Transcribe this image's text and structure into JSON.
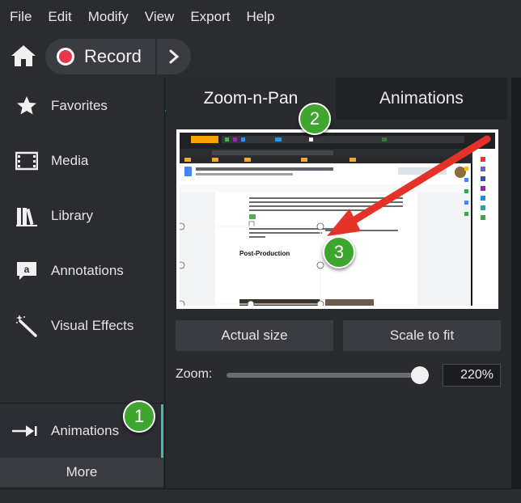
{
  "menubar": {
    "items": [
      "File",
      "Edit",
      "Modify",
      "View",
      "Export",
      "Help"
    ]
  },
  "toolbar": {
    "home_icon": "home-icon",
    "record_label": "Record",
    "next_icon": "chevron-right-icon"
  },
  "sidebar": {
    "items": [
      {
        "label": "Favorites",
        "icon": "star-icon"
      },
      {
        "label": "Media",
        "icon": "film-icon"
      },
      {
        "label": "Library",
        "icon": "books-icon"
      },
      {
        "label": "Annotations",
        "icon": "annotation-icon"
      },
      {
        "label": "Visual Effects",
        "icon": "magic-wand-icon"
      },
      {
        "label": "Animations",
        "icon": "animation-arrow-icon"
      }
    ],
    "active": "Animations",
    "more_label": "More"
  },
  "panel": {
    "tabs": [
      "Zoom-n-Pan",
      "Animations"
    ],
    "active_tab": "Zoom-n-Pan",
    "preview_content": {
      "heading": "Post-Production"
    },
    "actual_size_label": "Actual size",
    "scale_to_fit_label": "Scale to fit",
    "zoom_label": "Zoom:",
    "zoom_value": "220%",
    "zoom_fraction": 0.98
  },
  "callouts": [
    "1",
    "2",
    "3"
  ],
  "colors": {
    "accent": "#2fc3ab",
    "record": "#e8374a",
    "callout": "#3ea62e",
    "arrow": "#e53228"
  }
}
